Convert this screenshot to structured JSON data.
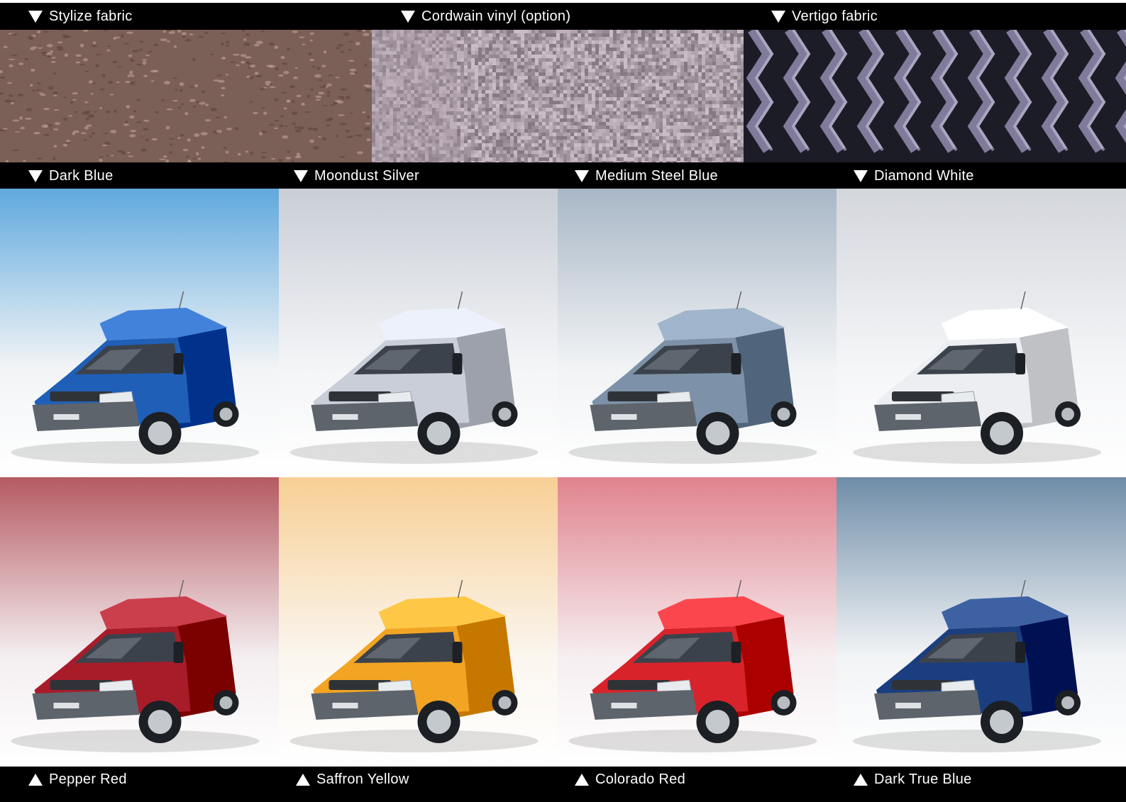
{
  "fabrics": [
    {
      "label": "Stylize fabric",
      "pattern": "stylize",
      "base": "#7b6058"
    },
    {
      "label": "Cordwain vinyl (option)",
      "pattern": "cordwain",
      "base": "#a99aa4"
    },
    {
      "label": "Vertigo fabric",
      "pattern": "vertigo",
      "base": "#1c1c26"
    }
  ],
  "colors_top": [
    {
      "label": "Dark Blue",
      "van": "#1f5fb8",
      "bg_top": "#5fa9de",
      "bg_bottom": "#f2f4f6"
    },
    {
      "label": "Moondust Silver",
      "van": "#c9ced8",
      "bg_top": "#c9ced6",
      "bg_bottom": "#f4f5f7"
    },
    {
      "label": "Medium Steel Blue",
      "van": "#7d92a8",
      "bg_top": "#a8b7c6",
      "bg_bottom": "#f1f3f5"
    },
    {
      "label": "Diamond White",
      "van": "#eceef1",
      "bg_top": "#d3d6dc",
      "bg_bottom": "#f5f6f8"
    }
  ],
  "colors_bottom": [
    {
      "label": "Pepper Red",
      "van": "#a81c2a",
      "bg_top": "#b55a62",
      "bg_bottom": "#f4eef0"
    },
    {
      "label": "Saffron Yellow",
      "van": "#f2a423",
      "bg_top": "#f7cf95",
      "bg_bottom": "#fbf6ef"
    },
    {
      "label": "Colorado Red",
      "van": "#d8232b",
      "bg_top": "#e0838e",
      "bg_bottom": "#f6eef0"
    },
    {
      "label": "Dark True Blue",
      "van": "#1a3e80",
      "bg_top": "#6f8da8",
      "bg_bottom": "#f2f4f6"
    }
  ]
}
